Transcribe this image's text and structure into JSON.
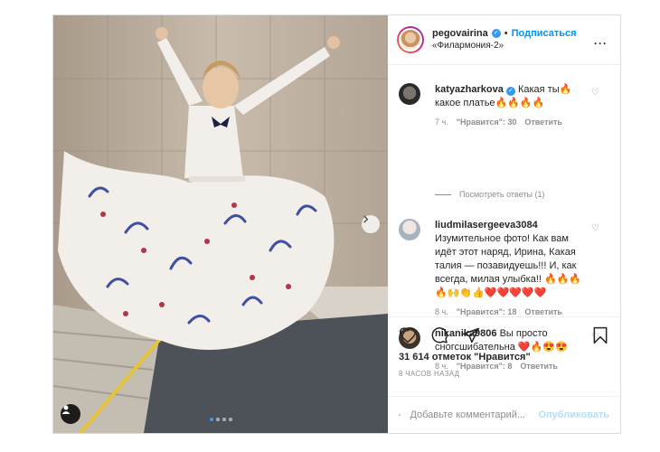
{
  "header": {
    "username": "pegovairina",
    "follow_label": "Подписаться",
    "location": "«Филармония-2»"
  },
  "comments": [
    {
      "username": "katyazharkova",
      "verified": true,
      "text": "Какая ты🔥 какое платье🔥🔥🔥🔥",
      "time": "7 ч.",
      "likes": "\"Нравится\": 30",
      "reply": "Ответить",
      "view_replies": "Посмотреть ответы (1)"
    },
    {
      "username": "liudmilasergeeva3084",
      "verified": false,
      "text": "Изумительное фото! Как вам идёт этот наряд, Ирина, Какая талия — позавидуешь!!! И, как всегда, милая улыбка!! 🔥🔥🔥🔥🙌👏👍❤️❤️❤️❤️❤️",
      "time": "8 ч.",
      "likes": "\"Нравится\": 18",
      "reply": "Ответить"
    },
    {
      "username": "nikanika9806",
      "verified": false,
      "text": "Вы просто сногсшибательна ❤️🔥😍😍",
      "time": "8 ч.",
      "likes": "\"Нравится\": 8",
      "reply": "Ответить"
    }
  ],
  "actions": {
    "likes_text": "31 614 отметок \"Нравится\"",
    "time_ago": "8 ЧАСОВ НАЗАД"
  },
  "add_comment": {
    "placeholder": "Добавьте комментарий...",
    "publish_label": "Опубликовать"
  },
  "carousel": {
    "slide_count": 4,
    "active_slide": 1
  },
  "colors": {
    "accent": "#0095f6",
    "verified": "#3897f0",
    "muted": "#8e8e8e"
  },
  "icons": [
    "more-options-icon",
    "heart-icon",
    "comment-icon",
    "share-icon",
    "bookmark-icon",
    "smile-icon",
    "next-arrow-icon",
    "user-tag-icon"
  ]
}
